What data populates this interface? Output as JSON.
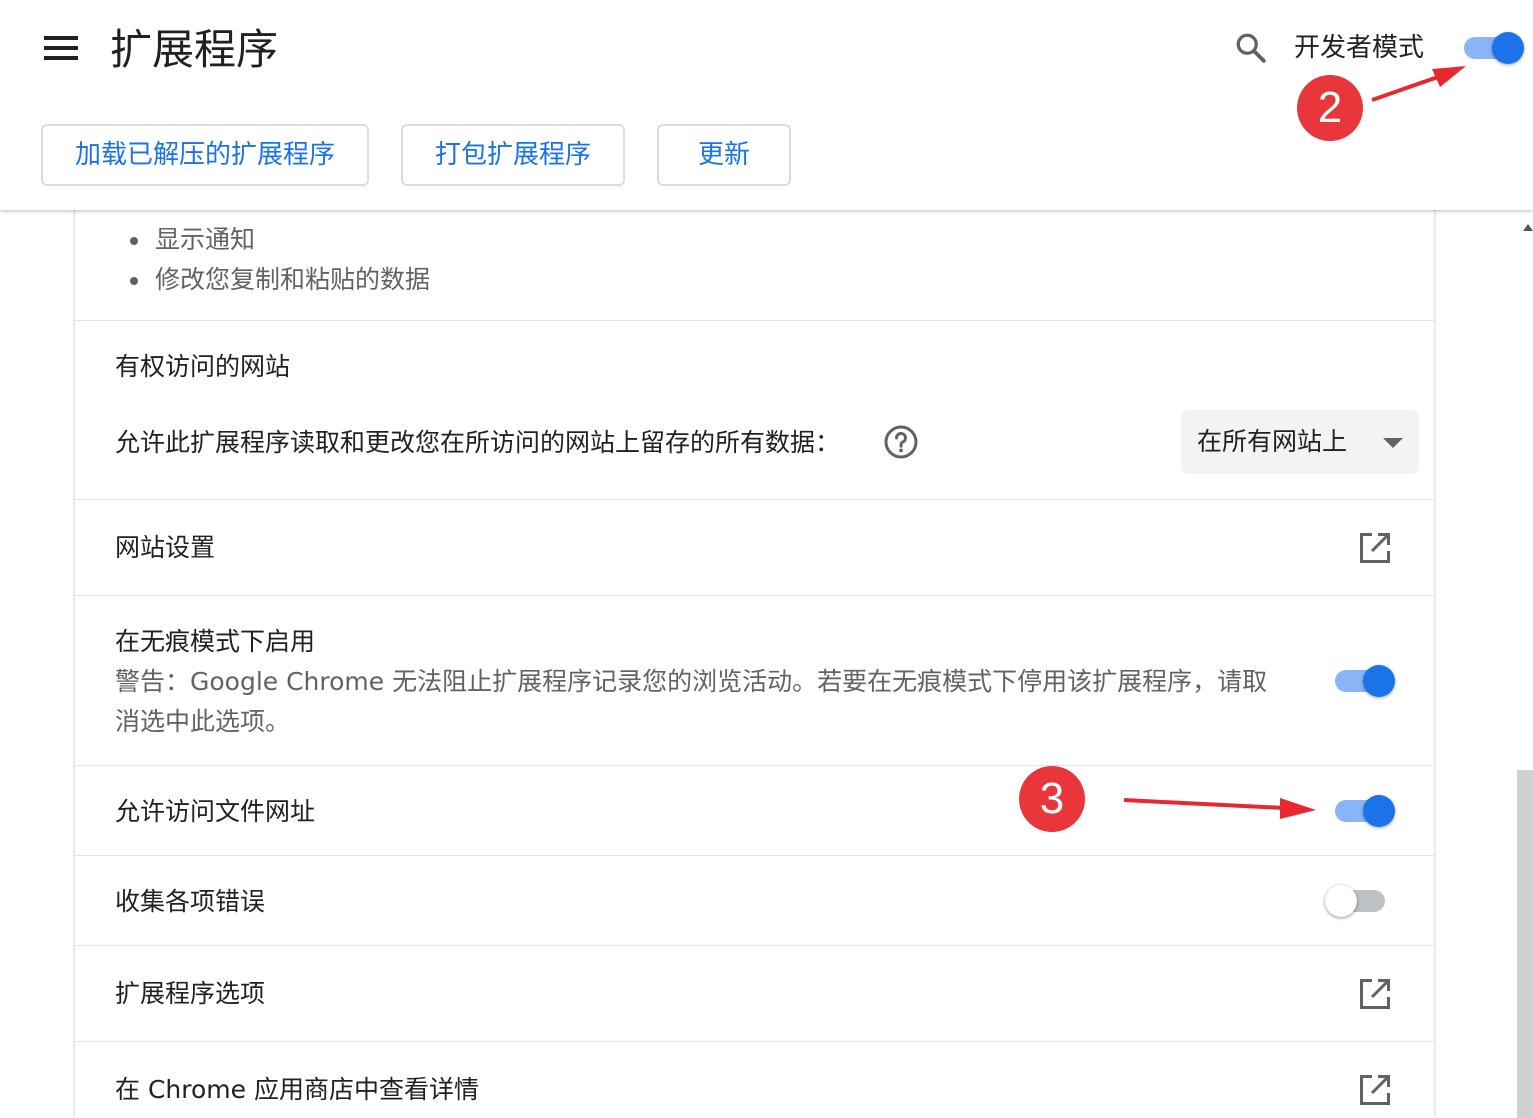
{
  "header": {
    "title": "扩展程序",
    "developer_mode_label": "开发者模式",
    "developer_mode_on": true,
    "buttons": {
      "load_unpacked": "加载已解压的扩展程序",
      "pack": "打包扩展程序",
      "update": "更新"
    }
  },
  "annotations": {
    "badge_2": "2",
    "badge_3": "3"
  },
  "details": {
    "permissions": [
      "显示通知",
      "修改您复制和粘贴的数据"
    ],
    "site_access": {
      "title": "有权访问的网站",
      "description": "允许此扩展程序读取和更改您在所访问的网站上留存的所有数据：",
      "selected": "在所有网站上"
    },
    "site_settings": {
      "label": "网站设置"
    },
    "incognito": {
      "title": "在无痕模式下启用",
      "warning": "警告：Google Chrome 无法阻止扩展程序记录您的浏览活动。若要在无痕模式下停用该扩展程序，请取消选中此选项。",
      "on": true
    },
    "file_urls": {
      "label": "允许访问文件网址",
      "on": true
    },
    "collect_errors": {
      "label": "收集各项错误",
      "on": false
    },
    "extension_options": {
      "label": "扩展程序选项"
    },
    "web_store": {
      "label": "在 Chrome 应用商店中查看详情"
    }
  },
  "colors": {
    "accent": "#1a73e8",
    "toggle_track_on": "#8ab4f8",
    "badge": "#e8363b",
    "arrow": "#e8282e"
  },
  "icons": {
    "menu": "hamburger-icon",
    "search": "search-icon",
    "help": "help-circle-icon",
    "dropdown": "caret-down-icon",
    "external": "open-in-new-icon"
  }
}
